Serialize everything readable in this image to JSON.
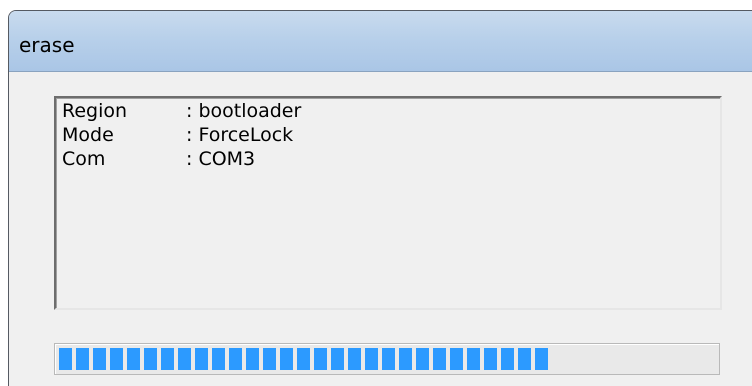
{
  "window": {
    "title": "erase"
  },
  "log": {
    "rows": [
      {
        "key": "Region",
        "value": ": bootloader"
      },
      {
        "key": "Mode",
        "value": ": ForceLock"
      },
      {
        "key": "Com",
        "value": ": COM3"
      }
    ]
  },
  "progress": {
    "fraction": 0.74,
    "color": "#2c9aff"
  },
  "colors": {
    "titlebar": "#b8d0ea",
    "window_background": "#f0f0f0"
  }
}
